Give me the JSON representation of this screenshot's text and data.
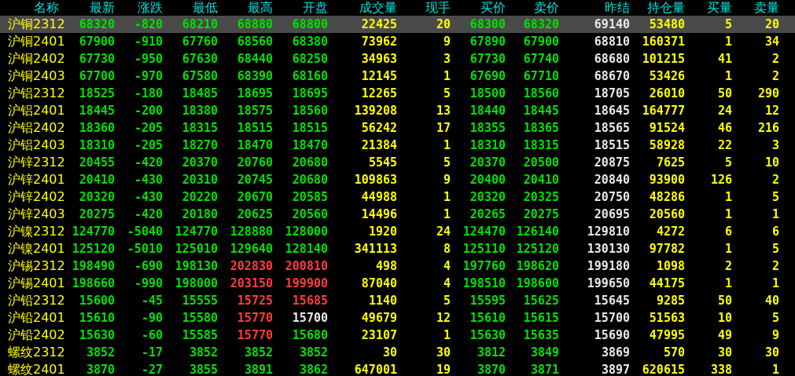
{
  "columns": [
    {
      "label": "名称",
      "kind": "name"
    },
    {
      "label": "最新",
      "kind": "price"
    },
    {
      "label": "涨跌",
      "kind": "price"
    },
    {
      "label": "最低",
      "kind": "price"
    },
    {
      "label": "最高",
      "kind": "price"
    },
    {
      "label": "开盘",
      "kind": "price"
    },
    {
      "label": "成交量",
      "kind": "qty"
    },
    {
      "label": "现手",
      "kind": "qty"
    },
    {
      "label": "买价",
      "kind": "price"
    },
    {
      "label": "卖价",
      "kind": "price"
    },
    {
      "label": "昨结",
      "kind": "settle"
    },
    {
      "label": "持仓量",
      "kind": "qty"
    },
    {
      "label": "买量",
      "kind": "qty"
    },
    {
      "label": "卖量",
      "kind": "qty"
    }
  ],
  "rows": [
    {
      "selected": true,
      "cells": [
        "沪铜2312",
        {
          "text": "68320",
          "color": "#00e000"
        },
        {
          "text": "-820",
          "color": "#00e000"
        },
        {
          "text": "68210",
          "color": "#00e000"
        },
        {
          "text": "68880",
          "color": "#00e000"
        },
        {
          "text": "68800",
          "color": "#00e000"
        },
        "22425",
        "20",
        {
          "text": "68300",
          "color": "#00e000"
        },
        {
          "text": "68320",
          "color": "#00e000"
        },
        "69140",
        "53480",
        "5",
        "20"
      ]
    },
    {
      "selected": false,
      "cells": [
        "沪铜2401",
        {
          "text": "67900",
          "color": "#00e000"
        },
        {
          "text": "-910",
          "color": "#00e000"
        },
        {
          "text": "67760",
          "color": "#00e000"
        },
        {
          "text": "68560",
          "color": "#00e000"
        },
        {
          "text": "68380",
          "color": "#00e000"
        },
        "73962",
        "9",
        {
          "text": "67890",
          "color": "#00e000"
        },
        {
          "text": "67900",
          "color": "#00e000"
        },
        "68810",
        "160371",
        "1",
        "34"
      ]
    },
    {
      "selected": false,
      "cells": [
        "沪铜2402",
        {
          "text": "67730",
          "color": "#00e000"
        },
        {
          "text": "-950",
          "color": "#00e000"
        },
        {
          "text": "67630",
          "color": "#00e000"
        },
        {
          "text": "68440",
          "color": "#00e000"
        },
        {
          "text": "68250",
          "color": "#00e000"
        },
        "34963",
        "3",
        {
          "text": "67730",
          "color": "#00e000"
        },
        {
          "text": "67740",
          "color": "#00e000"
        },
        "68680",
        "101215",
        "41",
        "2"
      ]
    },
    {
      "selected": false,
      "cells": [
        "沪铜2403",
        {
          "text": "67700",
          "color": "#00e000"
        },
        {
          "text": "-970",
          "color": "#00e000"
        },
        {
          "text": "67580",
          "color": "#00e000"
        },
        {
          "text": "68390",
          "color": "#00e000"
        },
        {
          "text": "68160",
          "color": "#00e000"
        },
        "12145",
        "1",
        {
          "text": "67690",
          "color": "#00e000"
        },
        {
          "text": "67710",
          "color": "#00e000"
        },
        "68670",
        "53426",
        "1",
        "2"
      ]
    },
    {
      "selected": false,
      "cells": [
        "沪铝2312",
        {
          "text": "18525",
          "color": "#00e000"
        },
        {
          "text": "-180",
          "color": "#00e000"
        },
        {
          "text": "18485",
          "color": "#00e000"
        },
        {
          "text": "18695",
          "color": "#00e000"
        },
        {
          "text": "18695",
          "color": "#00e000"
        },
        "12265",
        "5",
        {
          "text": "18500",
          "color": "#00e000"
        },
        {
          "text": "18560",
          "color": "#00e000"
        },
        "18705",
        "26010",
        "50",
        "290"
      ]
    },
    {
      "selected": false,
      "cells": [
        "沪铝2401",
        {
          "text": "18445",
          "color": "#00e000"
        },
        {
          "text": "-200",
          "color": "#00e000"
        },
        {
          "text": "18380",
          "color": "#00e000"
        },
        {
          "text": "18575",
          "color": "#00e000"
        },
        {
          "text": "18560",
          "color": "#00e000"
        },
        "139208",
        "13",
        {
          "text": "18440",
          "color": "#00e000"
        },
        {
          "text": "18445",
          "color": "#00e000"
        },
        "18645",
        "164777",
        "24",
        "12"
      ]
    },
    {
      "selected": false,
      "cells": [
        "沪铝2402",
        {
          "text": "18360",
          "color": "#00e000"
        },
        {
          "text": "-205",
          "color": "#00e000"
        },
        {
          "text": "18315",
          "color": "#00e000"
        },
        {
          "text": "18515",
          "color": "#00e000"
        },
        {
          "text": "18515",
          "color": "#00e000"
        },
        "56242",
        "17",
        {
          "text": "18355",
          "color": "#00e000"
        },
        {
          "text": "18365",
          "color": "#00e000"
        },
        "18565",
        "91524",
        "46",
        "216"
      ]
    },
    {
      "selected": false,
      "cells": [
        "沪铝2403",
        {
          "text": "18310",
          "color": "#00e000"
        },
        {
          "text": "-205",
          "color": "#00e000"
        },
        {
          "text": "18270",
          "color": "#00e000"
        },
        {
          "text": "18470",
          "color": "#00e000"
        },
        {
          "text": "18470",
          "color": "#00e000"
        },
        "21384",
        "1",
        {
          "text": "18310",
          "color": "#00e000"
        },
        {
          "text": "18315",
          "color": "#00e000"
        },
        "18515",
        "58928",
        "22",
        "3"
      ]
    },
    {
      "selected": false,
      "cells": [
        "沪锌2312",
        {
          "text": "20455",
          "color": "#00e000"
        },
        {
          "text": "-420",
          "color": "#00e000"
        },
        {
          "text": "20370",
          "color": "#00e000"
        },
        {
          "text": "20760",
          "color": "#00e000"
        },
        {
          "text": "20680",
          "color": "#00e000"
        },
        "5545",
        "5",
        {
          "text": "20370",
          "color": "#00e000"
        },
        {
          "text": "20500",
          "color": "#00e000"
        },
        "20875",
        "7625",
        "5",
        "10"
      ]
    },
    {
      "selected": false,
      "cells": [
        "沪锌2401",
        {
          "text": "20410",
          "color": "#00e000"
        },
        {
          "text": "-430",
          "color": "#00e000"
        },
        {
          "text": "20310",
          "color": "#00e000"
        },
        {
          "text": "20745",
          "color": "#00e000"
        },
        {
          "text": "20680",
          "color": "#00e000"
        },
        "109863",
        "9",
        {
          "text": "20400",
          "color": "#00e000"
        },
        {
          "text": "20410",
          "color": "#00e000"
        },
        "20840",
        "93900",
        "126",
        "2"
      ]
    },
    {
      "selected": false,
      "cells": [
        "沪锌2402",
        {
          "text": "20320",
          "color": "#00e000"
        },
        {
          "text": "-430",
          "color": "#00e000"
        },
        {
          "text": "20220",
          "color": "#00e000"
        },
        {
          "text": "20670",
          "color": "#00e000"
        },
        {
          "text": "20585",
          "color": "#00e000"
        },
        "44988",
        "1",
        {
          "text": "20320",
          "color": "#00e000"
        },
        {
          "text": "20325",
          "color": "#00e000"
        },
        "20750",
        "48286",
        "1",
        "5"
      ]
    },
    {
      "selected": false,
      "cells": [
        "沪锌2403",
        {
          "text": "20275",
          "color": "#00e000"
        },
        {
          "text": "-420",
          "color": "#00e000"
        },
        {
          "text": "20180",
          "color": "#00e000"
        },
        {
          "text": "20625",
          "color": "#00e000"
        },
        {
          "text": "20560",
          "color": "#00e000"
        },
        "14496",
        "1",
        {
          "text": "20265",
          "color": "#00e000"
        },
        {
          "text": "20275",
          "color": "#00e000"
        },
        "20695",
        "20560",
        "1",
        "1"
      ]
    },
    {
      "selected": false,
      "cells": [
        "沪镍2312",
        {
          "text": "124770",
          "color": "#00e000"
        },
        {
          "text": "-5040",
          "color": "#00e000"
        },
        {
          "text": "124770",
          "color": "#00e000"
        },
        {
          "text": "128880",
          "color": "#00e000"
        },
        {
          "text": "128000",
          "color": "#00e000"
        },
        "1920",
        "24",
        {
          "text": "124470",
          "color": "#00e000"
        },
        {
          "text": "126140",
          "color": "#00e000"
        },
        "129810",
        "4272",
        "6",
        "6"
      ]
    },
    {
      "selected": false,
      "cells": [
        "沪镍2401",
        {
          "text": "125120",
          "color": "#00e000"
        },
        {
          "text": "-5010",
          "color": "#00e000"
        },
        {
          "text": "125010",
          "color": "#00e000"
        },
        {
          "text": "129640",
          "color": "#00e000"
        },
        {
          "text": "128140",
          "color": "#00e000"
        },
        "341113",
        "8",
        {
          "text": "125110",
          "color": "#00e000"
        },
        {
          "text": "125120",
          "color": "#00e000"
        },
        "130130",
        "97782",
        "1",
        "5"
      ]
    },
    {
      "selected": false,
      "cells": [
        "沪锡2312",
        {
          "text": "198490",
          "color": "#00e000"
        },
        {
          "text": "-690",
          "color": "#00e000"
        },
        {
          "text": "198130",
          "color": "#00e000"
        },
        {
          "text": "202830",
          "color": "#ff3c3c"
        },
        {
          "text": "200810",
          "color": "#ff3c3c"
        },
        "498",
        "4",
        {
          "text": "197760",
          "color": "#00e000"
        },
        {
          "text": "198620",
          "color": "#00e000"
        },
        "199180",
        "1098",
        "2",
        "2"
      ]
    },
    {
      "selected": false,
      "cells": [
        "沪锡2401",
        {
          "text": "198660",
          "color": "#00e000"
        },
        {
          "text": "-990",
          "color": "#00e000"
        },
        {
          "text": "198000",
          "color": "#00e000"
        },
        {
          "text": "203150",
          "color": "#ff3c3c"
        },
        {
          "text": "199900",
          "color": "#ff3c3c"
        },
        "87040",
        "4",
        {
          "text": "198510",
          "color": "#00e000"
        },
        {
          "text": "198600",
          "color": "#00e000"
        },
        "199650",
        "44175",
        "1",
        "1"
      ]
    },
    {
      "selected": false,
      "cells": [
        "沪铅2312",
        {
          "text": "15600",
          "color": "#00e000"
        },
        {
          "text": "-45",
          "color": "#00e000"
        },
        {
          "text": "15555",
          "color": "#00e000"
        },
        {
          "text": "15725",
          "color": "#ff3c3c"
        },
        {
          "text": "15685",
          "color": "#ff3c3c"
        },
        "1140",
        "5",
        {
          "text": "15595",
          "color": "#00e000"
        },
        {
          "text": "15625",
          "color": "#00e000"
        },
        "15645",
        "9285",
        "50",
        "40"
      ]
    },
    {
      "selected": false,
      "cells": [
        "沪铅2401",
        {
          "text": "15610",
          "color": "#00e000"
        },
        {
          "text": "-90",
          "color": "#00e000"
        },
        {
          "text": "15580",
          "color": "#00e000"
        },
        {
          "text": "15770",
          "color": "#ff3c3c"
        },
        {
          "text": "15700",
          "color": "#e8e8e8"
        },
        "49679",
        "12",
        {
          "text": "15610",
          "color": "#00e000"
        },
        {
          "text": "15615",
          "color": "#00e000"
        },
        "15700",
        "51563",
        "10",
        "5"
      ]
    },
    {
      "selected": false,
      "cells": [
        "沪铅2402",
        {
          "text": "15630",
          "color": "#00e000"
        },
        {
          "text": "-60",
          "color": "#00e000"
        },
        {
          "text": "15585",
          "color": "#00e000"
        },
        {
          "text": "15770",
          "color": "#ff3c3c"
        },
        {
          "text": "15680",
          "color": "#00e000"
        },
        "23107",
        "1",
        {
          "text": "15630",
          "color": "#00e000"
        },
        {
          "text": "15635",
          "color": "#00e000"
        },
        "15690",
        "47995",
        "49",
        "9"
      ]
    },
    {
      "selected": false,
      "cells": [
        "螺纹2312",
        {
          "text": "3852",
          "color": "#00e000"
        },
        {
          "text": "-17",
          "color": "#00e000"
        },
        {
          "text": "3852",
          "color": "#00e000"
        },
        {
          "text": "3852",
          "color": "#00e000"
        },
        {
          "text": "3852",
          "color": "#00e000"
        },
        "30",
        "30",
        {
          "text": "3812",
          "color": "#00e000"
        },
        {
          "text": "3849",
          "color": "#00e000"
        },
        "3869",
        "570",
        "30",
        "30"
      ]
    },
    {
      "selected": false,
      "cells": [
        "螺纹2401",
        {
          "text": "3870",
          "color": "#00e000"
        },
        {
          "text": "-27",
          "color": "#00e000"
        },
        {
          "text": "3855",
          "color": "#00e000"
        },
        {
          "text": "3891",
          "color": "#00e000"
        },
        {
          "text": "3862",
          "color": "#00e000"
        },
        "647001",
        "19",
        {
          "text": "3870",
          "color": "#00e000"
        },
        {
          "text": "3871",
          "color": "#00e000"
        },
        "3897",
        "620615",
        "338",
        "1"
      ]
    }
  ]
}
